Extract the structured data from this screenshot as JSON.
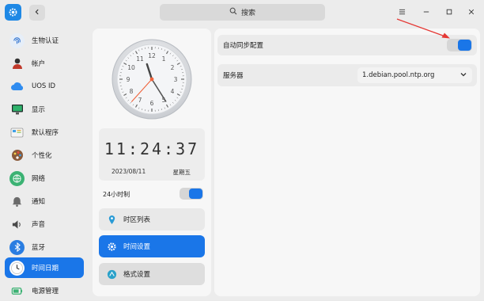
{
  "titlebar": {
    "search_placeholder": "搜索",
    "app_icon": "settings-gear-icon",
    "back_icon": "chevron-left-icon",
    "menu_icon": "hamburger-menu-icon",
    "minimize_icon": "minimize-icon",
    "maximize_icon": "maximize-icon",
    "close_icon": "close-icon"
  },
  "sidebar": {
    "items": [
      {
        "label": "生物认证",
        "icon": "fingerprint-icon",
        "active": false
      },
      {
        "label": "帐户",
        "icon": "user-icon",
        "active": false
      },
      {
        "label": "UOS ID",
        "icon": "cloud-icon",
        "active": false
      },
      {
        "label": "显示",
        "icon": "monitor-icon",
        "active": false
      },
      {
        "label": "默认程序",
        "icon": "default-apps-icon",
        "active": false
      },
      {
        "label": "个性化",
        "icon": "palette-icon",
        "active": false
      },
      {
        "label": "网络",
        "icon": "network-icon",
        "active": false
      },
      {
        "label": "通知",
        "icon": "bell-icon",
        "active": false
      },
      {
        "label": "声音",
        "icon": "speaker-icon",
        "active": false
      },
      {
        "label": "蓝牙",
        "icon": "bluetooth-icon",
        "active": false
      },
      {
        "label": "时间日期",
        "icon": "clock-icon",
        "active": true
      },
      {
        "label": "电源管理",
        "icon": "power-icon",
        "active": false
      }
    ]
  },
  "clock": {
    "digital_time": "11:24:37",
    "date": "2023/08/11",
    "weekday": "星期五",
    "hour": 11,
    "minute": 24,
    "second": 37,
    "numerals": [
      "12",
      "1",
      "2",
      "3",
      "4",
      "5",
      "6",
      "7",
      "8",
      "9",
      "10",
      "11"
    ]
  },
  "hour24": {
    "label": "24小时制",
    "enabled": true
  },
  "menu": [
    {
      "label": "时区列表",
      "icon": "location-pin-icon",
      "active": false
    },
    {
      "label": "时间设置",
      "icon": "gear-icon",
      "active": true
    },
    {
      "label": "格式设置",
      "icon": "format-icon",
      "active": false
    }
  ],
  "settings": {
    "auto_sync_label": "自动同步配置",
    "auto_sync_enabled": true,
    "server_label": "服务器",
    "server_value": "1.debian.pool.ntp.org"
  },
  "colors": {
    "accent": "#1a76e8",
    "annotation_arrow": "#e53935"
  }
}
